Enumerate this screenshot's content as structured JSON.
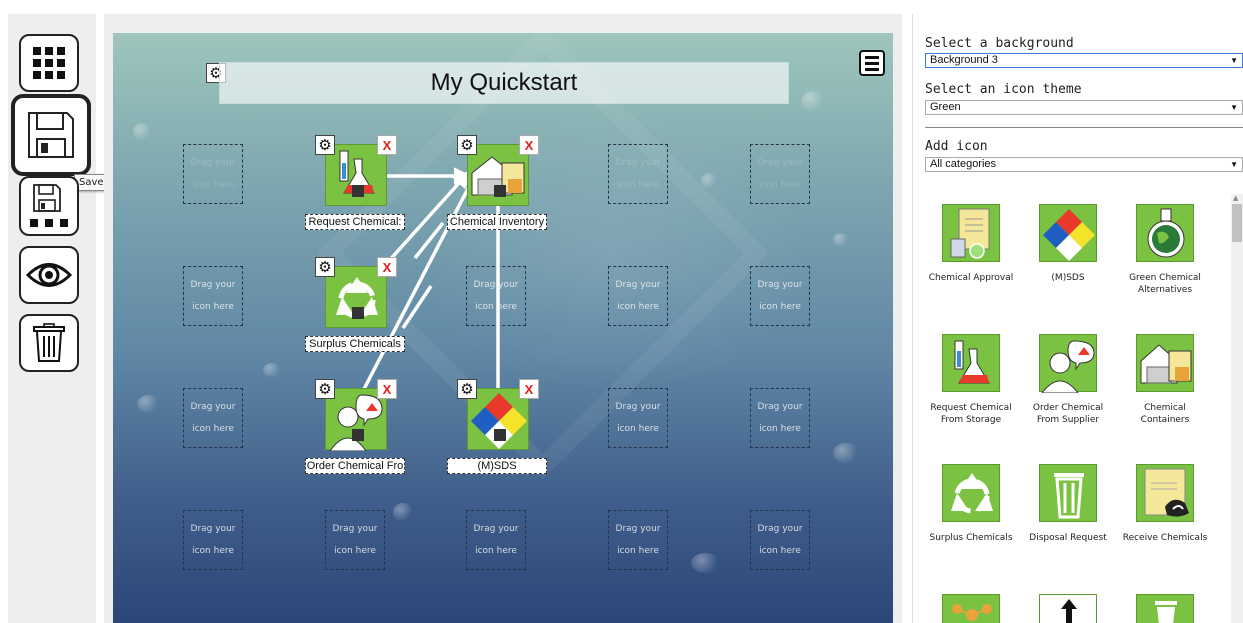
{
  "toolbar": {
    "tooltip": "Save design"
  },
  "canvas": {
    "title": "My Quickstart",
    "slot_text_line1": "Drag your",
    "slot_text_line2": "icon here",
    "placed_icons": [
      {
        "label": "Request Chemical:",
        "icon": "flask-icon"
      },
      {
        "label": "Chemical Inventory",
        "icon": "warehouse-icon"
      },
      {
        "label": "Surplus Chemicals",
        "icon": "recycle-icon"
      },
      {
        "label": "Order Chemical Fro",
        "icon": "person-icon"
      },
      {
        "label": "(M)SDS",
        "icon": "nfpa-diamond-icon"
      }
    ],
    "remove_symbol": "X"
  },
  "panel": {
    "background": {
      "label": "Select a background",
      "value": "Background 3"
    },
    "theme": {
      "label": "Select an icon theme",
      "value": "Green"
    },
    "add_icon": {
      "label": "Add icon",
      "value": "All categories"
    },
    "library": [
      {
        "caption": "Chemical Approval",
        "icon": "document-icon"
      },
      {
        "caption": "(M)SDS",
        "icon": "nfpa-diamond-icon"
      },
      {
        "caption": "Green Chemical Alternatives",
        "icon": "globe-flask-icon"
      },
      {
        "caption": "Request Chemical From Storage",
        "icon": "flask-icon"
      },
      {
        "caption": "Order Chemical From Supplier",
        "icon": "person-icon"
      },
      {
        "caption": "Chemical Containers",
        "icon": "warehouse-icon"
      },
      {
        "caption": "Surplus Chemicals",
        "icon": "recycle-icon"
      },
      {
        "caption": "Disposal Request",
        "icon": "trash-icon"
      },
      {
        "caption": "Receive Chemicals",
        "icon": "handshake-icon"
      }
    ]
  },
  "colors": {
    "icon_green": "#7cc242",
    "remove_red": "#e0201b",
    "canvas_top": "#9ec6bd",
    "canvas_bottom": "#2c4677"
  }
}
